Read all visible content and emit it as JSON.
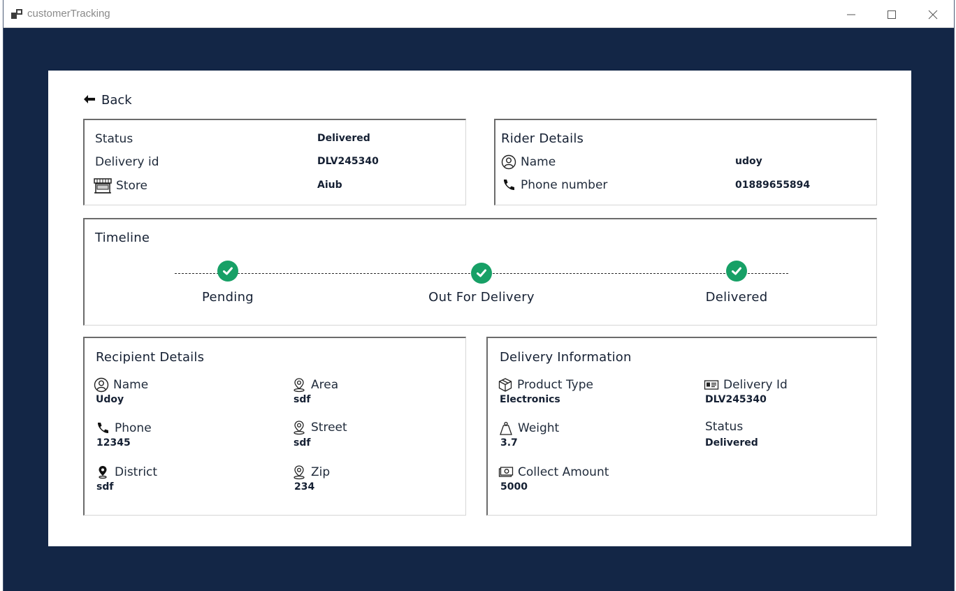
{
  "window": {
    "title": "customerTracking",
    "controls": [
      "minimize-icon",
      "maximize-icon",
      "close-icon"
    ]
  },
  "colors": {
    "frame_background": "#132646",
    "panel_background": "#ffffff",
    "accent_green": "#17a066",
    "text_dark": "#152033"
  },
  "back_label": "Back",
  "order_summary": {
    "status_label": "Status",
    "status_value": "Delivered",
    "delivery_id_label": "Delivery id",
    "delivery_id_value": "DLV245340",
    "store_label": "Store",
    "store_value": "Aiub"
  },
  "rider": {
    "title": "Rider Details",
    "name_label": "Name",
    "name_value": "udoy",
    "phone_label": "Phone number",
    "phone_value": "01889655894"
  },
  "timeline": {
    "title": "Timeline",
    "steps": [
      {
        "label": "Pending",
        "completed": true
      },
      {
        "label": "Out For Delivery",
        "completed": true
      },
      {
        "label": "Delivered",
        "completed": true
      }
    ]
  },
  "recipient": {
    "title": "Recipient Details",
    "name_label": "Name",
    "name_value": "Udoy",
    "phone_label": "Phone",
    "phone_value": "12345",
    "district_label": "District",
    "district_value": "sdf",
    "area_label": "Area",
    "area_value": "sdf",
    "street_label": "Street",
    "street_value": "sdf",
    "zip_label": "Zip",
    "zip_value": "234"
  },
  "delivery_info": {
    "title": "Delivery Information",
    "product_type_label": "Product Type",
    "product_type_value": "Electronics",
    "weight_label": "Weight",
    "weight_value": "3.7",
    "collect_amount_label": "Collect Amount",
    "collect_amount_value": "5000",
    "delivery_id_label": "Delivery Id",
    "delivery_id_value": "DLV245340",
    "status_label": "Status",
    "status_value": "Delivered"
  }
}
